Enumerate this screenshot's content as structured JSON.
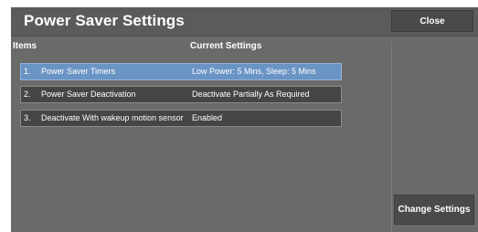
{
  "window": {
    "title": "Power Saver Settings",
    "close_label": "Close"
  },
  "table": {
    "headers": {
      "items": "Items",
      "current_settings": "Current Settings"
    },
    "rows": [
      {
        "number": "1.",
        "name": "Power Saver Timers",
        "setting": "Low Power: 5 Mins, Sleep: 5 Mins",
        "selected": true
      },
      {
        "number": "2.",
        "name": "Power Saver Deactivation",
        "setting": "Deactivate Partially As Required",
        "selected": false
      },
      {
        "number": "3.",
        "name": "Deactivate With wakeup motion sensor",
        "setting": "Enabled",
        "selected": false
      }
    ]
  },
  "actions": {
    "change_settings_label": "Change Settings"
  },
  "colors": {
    "background": "#6a6a68",
    "row_normal": "#454543",
    "row_selected": "#6a94c4",
    "button": "#4a4a48"
  }
}
